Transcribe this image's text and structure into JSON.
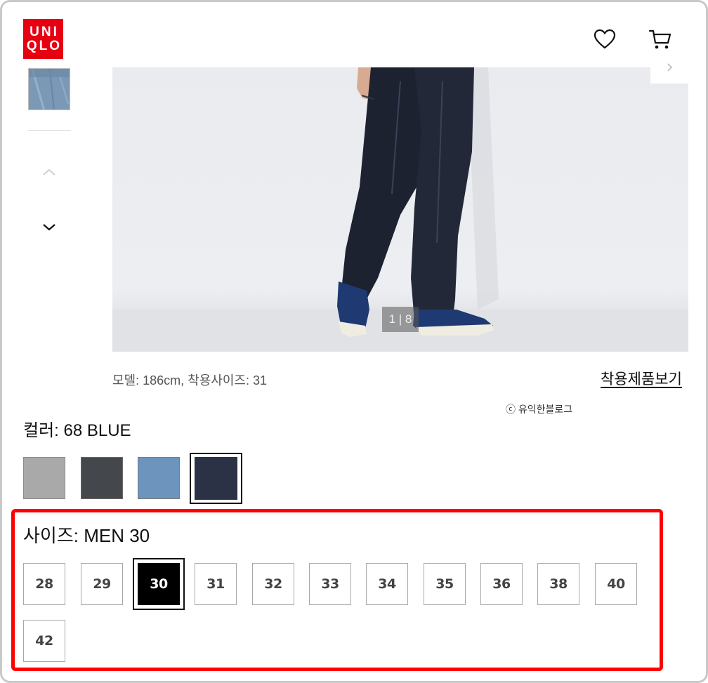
{
  "header": {
    "logo_line1": "UNI",
    "logo_line2": "QLO",
    "wishlist_icon": "heart-icon",
    "cart_icon": "cart-icon"
  },
  "gallery": {
    "counter": "1 | 8",
    "prev_icon": "chevron-up-icon",
    "next_icon": "chevron-down-icon",
    "image_next_icon": "chevron-right-icon"
  },
  "product": {
    "model_info": "모델: 186cm, 착용사이즈: 31",
    "view_worn_link": "착용제품보기",
    "watermark": "ⓒ 유익한블로그"
  },
  "color": {
    "label": "컬러:  68 BLUE",
    "swatches": [
      {
        "name": "gray",
        "color": "#a9a9a9"
      },
      {
        "name": "dark-gray",
        "color": "#44474c"
      },
      {
        "name": "light-blue",
        "color": "#6d94bd"
      },
      {
        "name": "blue",
        "color": "#2b3246",
        "selected": true
      }
    ]
  },
  "size": {
    "label": "사이즈:  MEN 30",
    "options": [
      "28",
      "29",
      "30",
      "31",
      "32",
      "33",
      "34",
      "35",
      "36",
      "38",
      "40",
      "42"
    ],
    "selected": "30"
  },
  "colors": {
    "brand_red": "#e60012",
    "highlight_red": "#ff0000",
    "selected_bg": "#000000"
  }
}
